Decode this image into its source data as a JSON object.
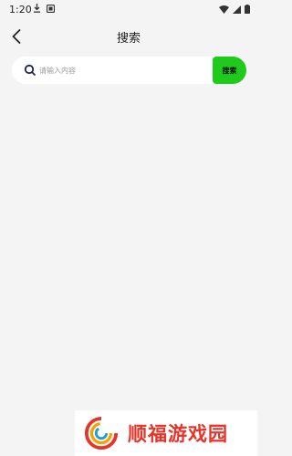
{
  "status_bar": {
    "time": "1:20"
  },
  "header": {
    "title": "搜索"
  },
  "search": {
    "placeholder": "请输入内容",
    "value": "",
    "button_label": "搜索"
  },
  "watermark": {
    "text": "顺福游戏园"
  },
  "colors": {
    "accent": "#1ecb1a",
    "background": "#f4f4f4",
    "watermark_red": "#e8332a"
  }
}
